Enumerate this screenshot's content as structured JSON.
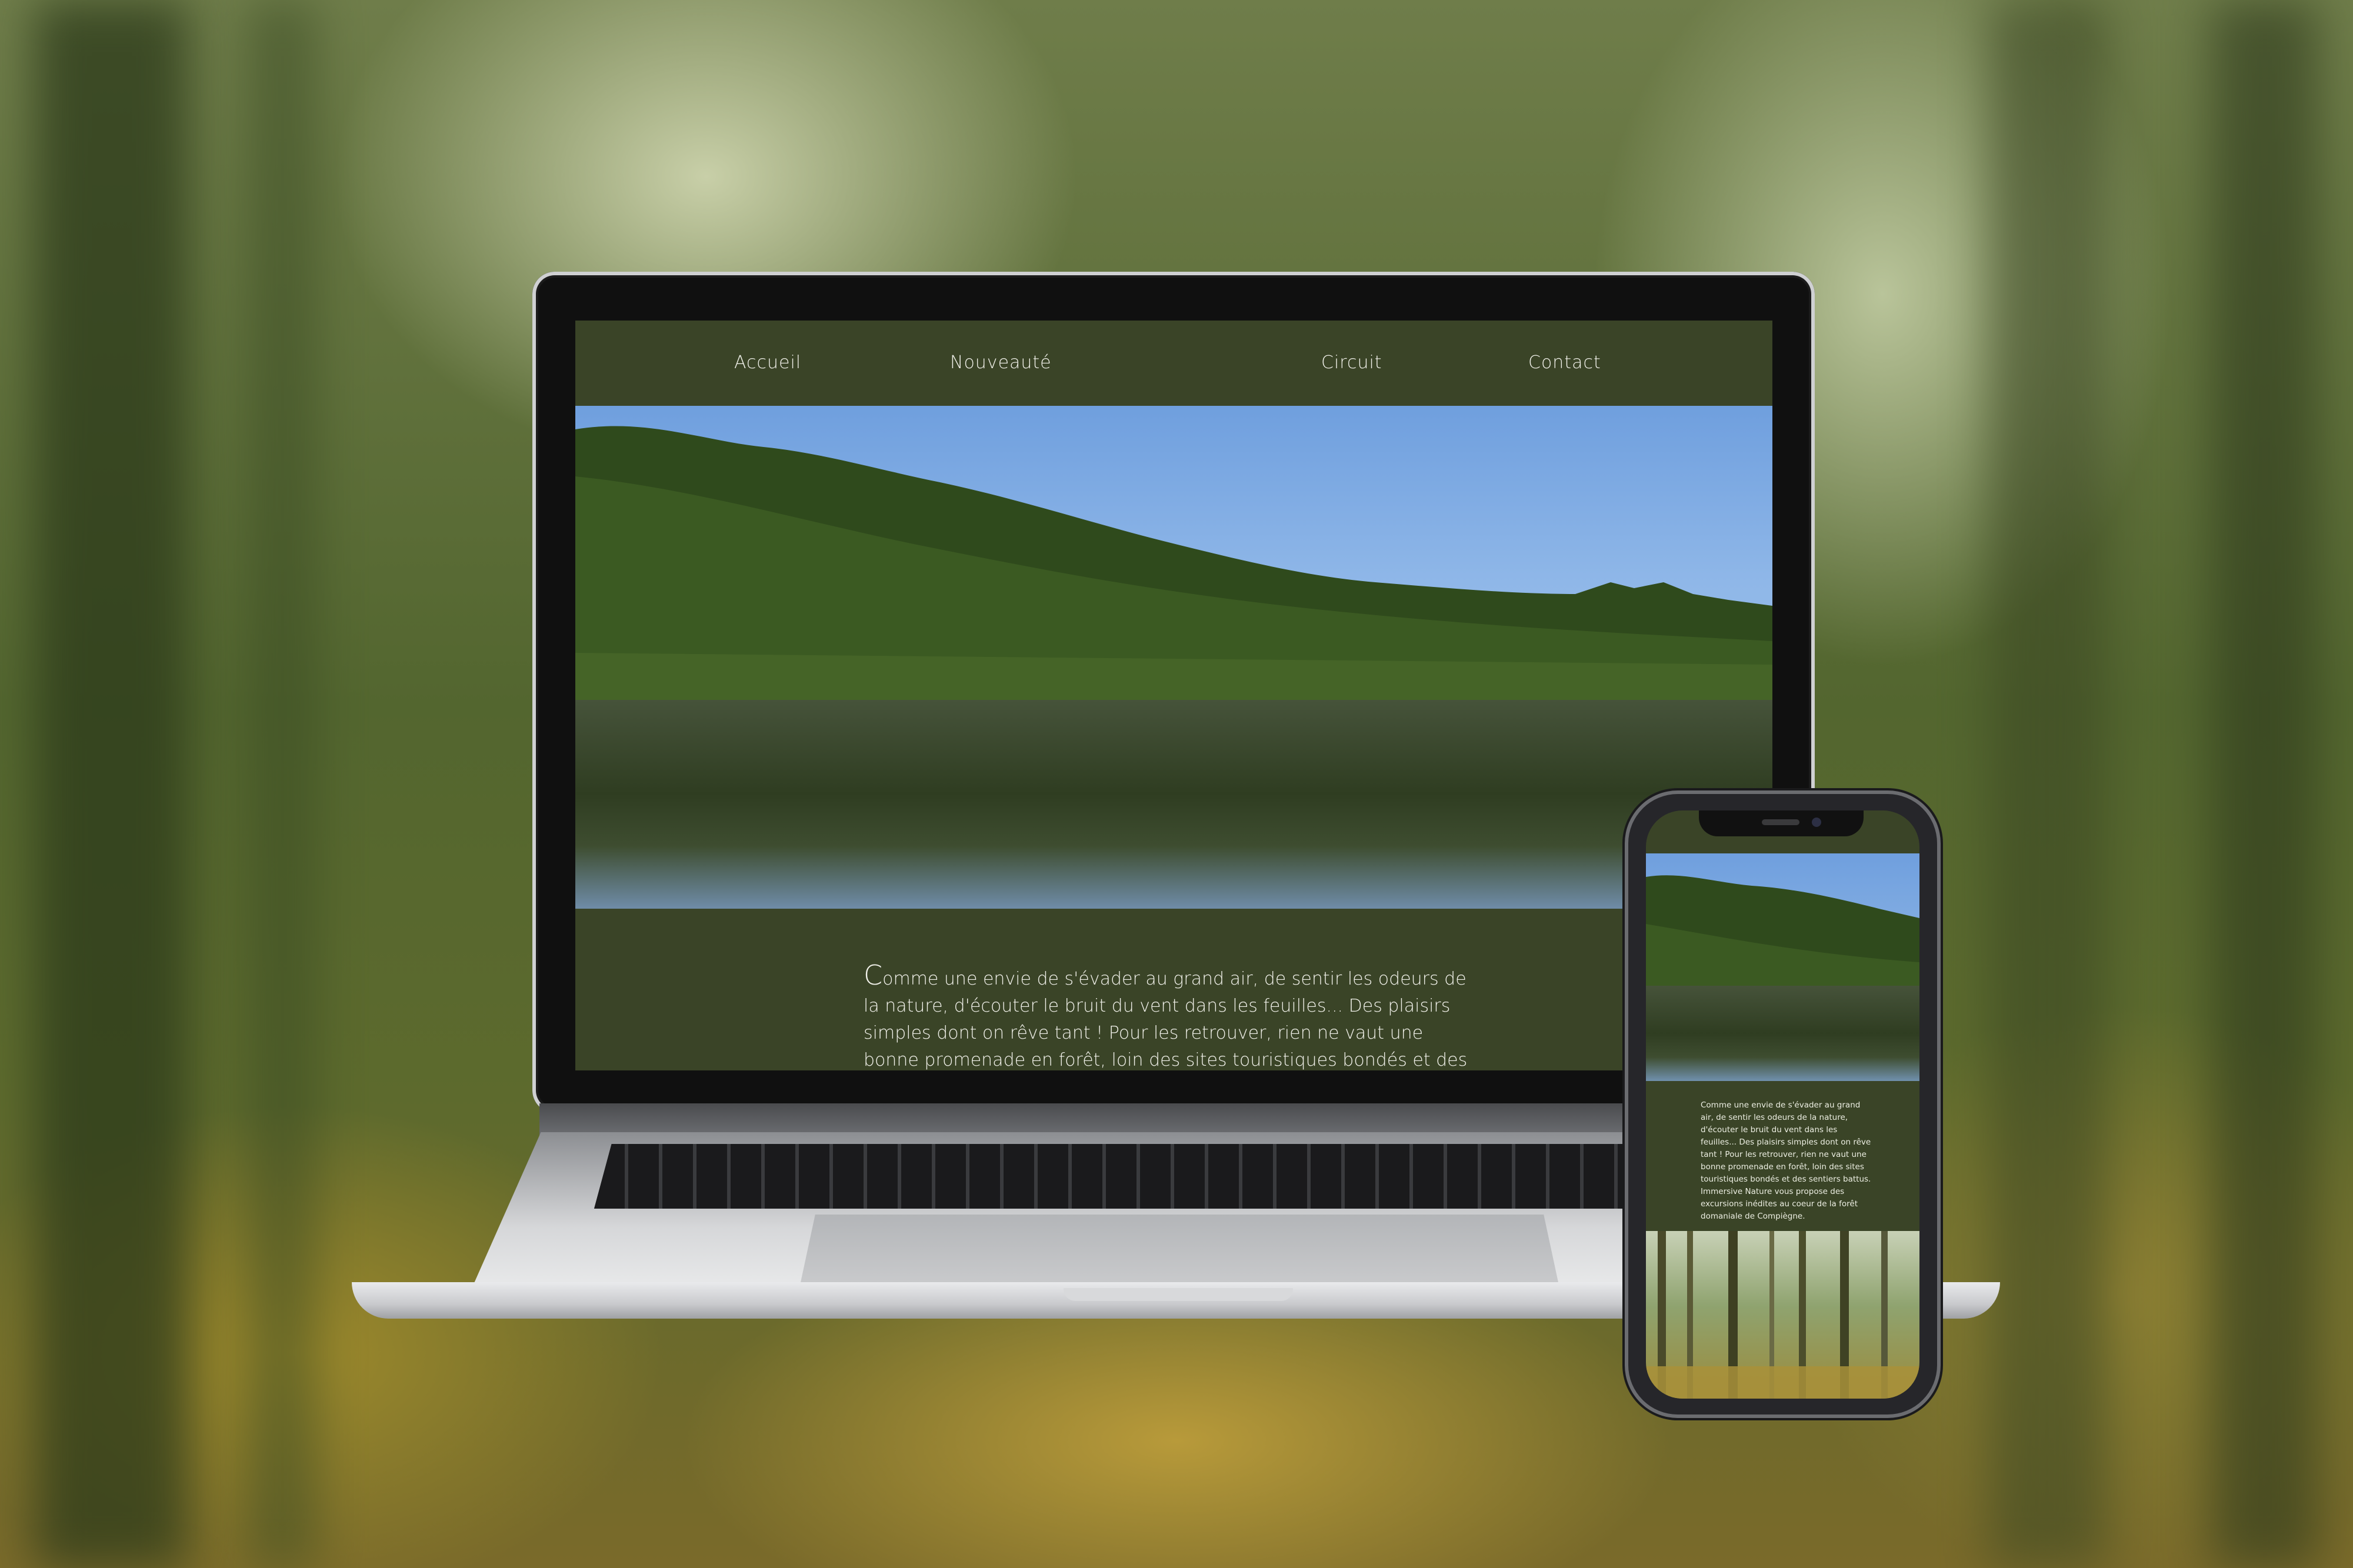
{
  "nav": {
    "items": [
      {
        "label": "Accueil"
      },
      {
        "label": "Nouveauté"
      },
      {
        "label": "Circuit"
      },
      {
        "label": "Contact"
      }
    ]
  },
  "intro": {
    "dropcap": "C",
    "text": "omme une envie de s'évader au grand air, de sentir les odeurs de la nature, d'écouter le bruit du vent dans les feuilles... Des plaisirs simples dont on rêve tant ! Pour les retrouver, rien ne vaut une bonne promenade en forêt, loin des sites touristiques bondés et des sentiers battus. Immersive Nature vous propose des excursions"
  },
  "phone": {
    "text": "Comme une envie de s'évader au grand air, de sentir les odeurs de la nature, d'écouter le bruit du vent dans les feuilles... Des plaisirs simples dont on rêve tant ! Pour les retrouver, rien ne vaut une bonne promenade en forêt, loin des sites touristiques bondés et des sentiers battus. Immersive Nature vous propose des excursions inédites au coeur de la forêt domaniale de Compiègne."
  },
  "colors": {
    "brand_green": "#3a4427",
    "text_light": "#f1f1ea"
  },
  "icons": {
    "phone_camera": "camera-icon"
  }
}
